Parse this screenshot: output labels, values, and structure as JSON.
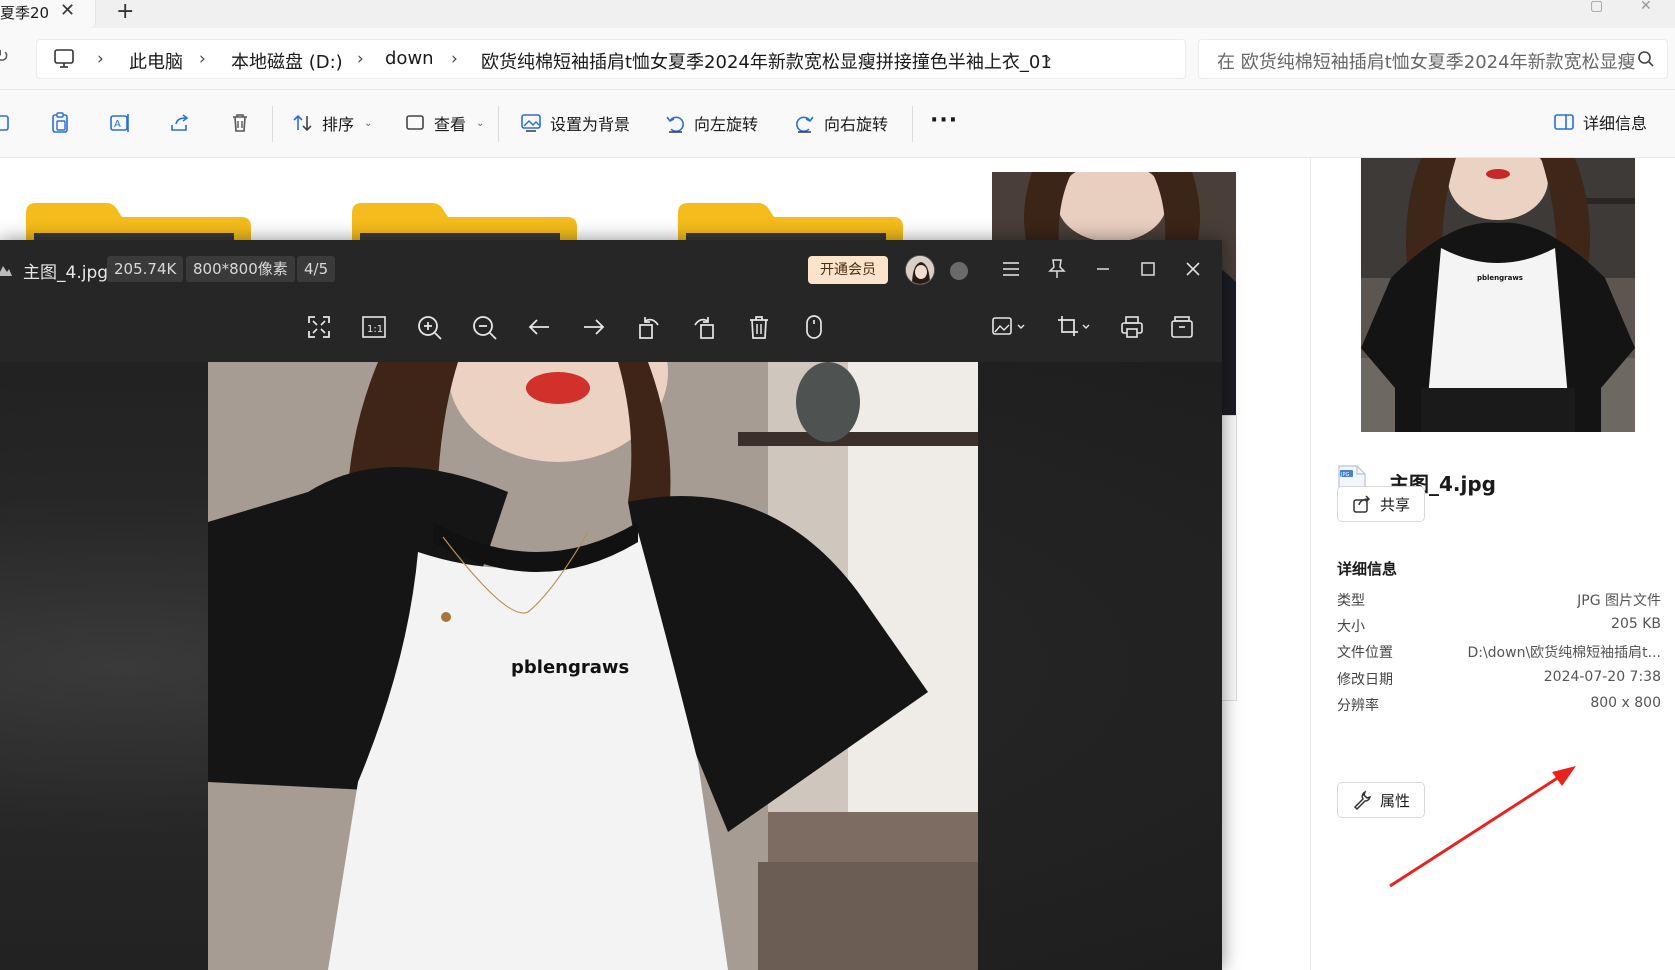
{
  "explorer": {
    "tab": {
      "title": "夏季20",
      "close_label": "✕",
      "add_label": "+"
    },
    "breadcrumb": {
      "items": [
        "此电脑",
        "本地磁盘 (D:)",
        "down",
        "欧货纯棉短袖插肩t恤女夏季2024年新款宽松显瘦拼接撞色半袖上衣_01"
      ]
    },
    "search": {
      "placeholder": "在 欧货纯棉短袖插肩t恤女夏季2024年新款宽松显瘦"
    },
    "commands": {
      "sort": "排序",
      "view": "查看",
      "set_background": "设置为背景",
      "rotate_left": "向左旋转",
      "rotate_right": "向右旋转",
      "more": "···",
      "details": "详细信息"
    },
    "details_pane": {
      "file_name": "主图_4.jpg",
      "share_label": "共享",
      "heading": "详细信息",
      "rows": [
        {
          "key": "类型",
          "value": "JPG 图片文件"
        },
        {
          "key": "大小",
          "value": "205 KB"
        },
        {
          "key": "文件位置",
          "value": "D:\\down\\欧货纯棉短袖插肩t..."
        },
        {
          "key": "修改日期",
          "value": "2024-07-20 7:38"
        },
        {
          "key": "分辨率",
          "value": "800 x 800"
        }
      ],
      "properties_label": "属性"
    }
  },
  "viewer": {
    "filename": "主图_4.jpg",
    "size": "205.74K",
    "dimensions": "800*800像素",
    "index": "4/5",
    "vip_label": "开通会员",
    "photo_text": "pblengraws"
  },
  "colors": {
    "viewer_bg": "#1f1f1f",
    "viewer_bar": "#262626",
    "vip_bg": "#fbe3cc",
    "folder_yellow": "#f4bc1c",
    "arrow_red": "#e8231e"
  }
}
